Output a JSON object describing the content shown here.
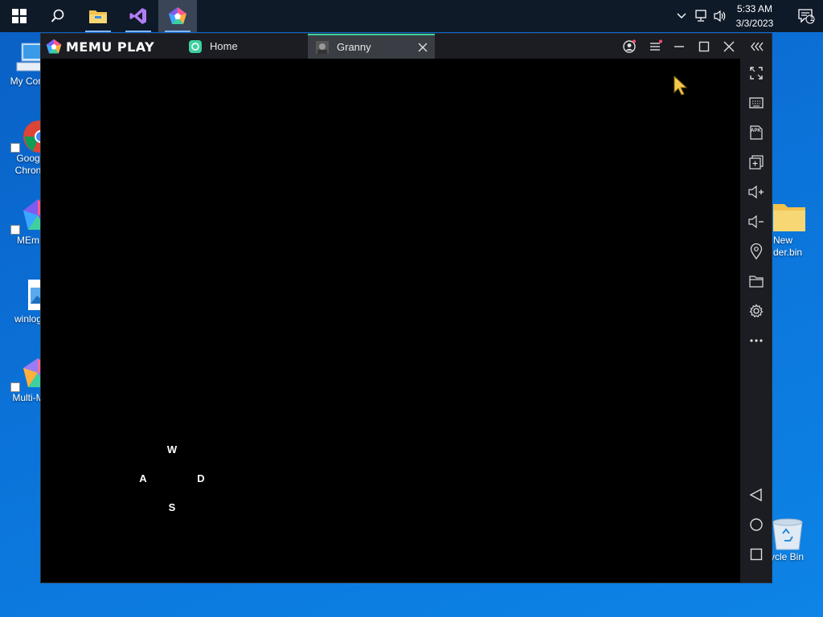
{
  "taskbar": {
    "clock": {
      "time": "5:33 AM",
      "date": "3/3/2023"
    },
    "notification_count": "1",
    "items": [
      "start",
      "search",
      "file-explorer",
      "visual-studio",
      "memu-play"
    ]
  },
  "desktop": {
    "icons": [
      {
        "label": "My Com"
      },
      {
        "label": "Goog"
      },
      {
        "label": "Chron"
      },
      {
        "label": "MEm"
      },
      {
        "label": "winlog"
      },
      {
        "label": "Multi-M"
      },
      {
        "label": "New"
      },
      {
        "label": "der.bin"
      },
      {
        "label": "ycle Bin"
      }
    ]
  },
  "emulator": {
    "logo_text": "MEMU PLAY",
    "tabs": [
      {
        "label": "Home"
      },
      {
        "label": "Granny"
      }
    ],
    "sidebar_icons": [
      "fullscreen-icon",
      "keyboard-icon",
      "apk-icon",
      "multi-instance-icon",
      "volume-up-icon",
      "volume-down-icon",
      "location-icon",
      "folder-icon",
      "settings-icon",
      "more-icon",
      "back-icon",
      "home-icon",
      "recents-icon"
    ],
    "apk_label": "APK",
    "keymap": {
      "up": "W",
      "left": "A",
      "right": "D",
      "down": "S"
    }
  },
  "colors": {
    "taskbar_bg": "#0f1a29",
    "desktop_blue": "#0b72d8",
    "emu_titlebar": "#1b1d22",
    "active_tab": "#3a3d44",
    "tab_accent": "#3fd0a0",
    "cursor_yellow": "#f2c94c"
  }
}
